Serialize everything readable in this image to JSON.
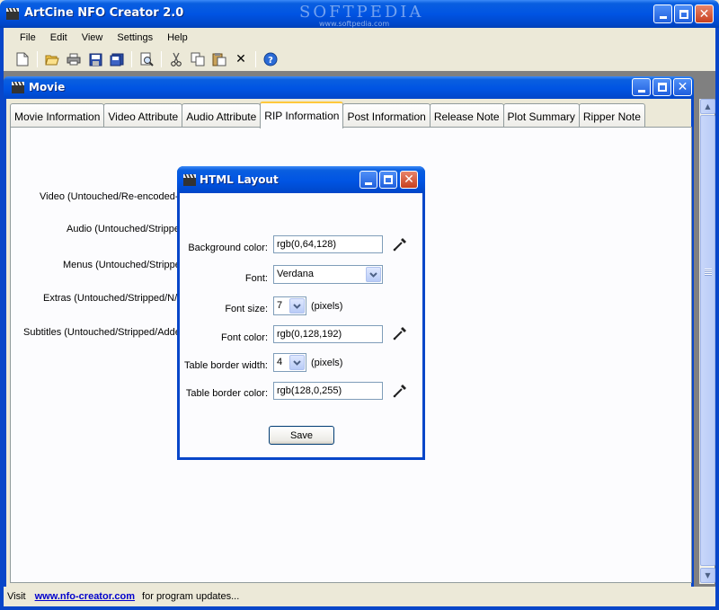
{
  "app": {
    "title": "ArtCine NFO Creator 2.0",
    "watermark": "SOFTPEDIA",
    "watermark_url": "www.softpedia.com"
  },
  "menu": [
    "File",
    "Edit",
    "View",
    "Settings",
    "Help"
  ],
  "toolbar": {
    "icons": [
      "new-icon",
      "open-icon",
      "print-icon",
      "save-icon",
      "save-as-icon",
      "preview-icon",
      "cut-icon",
      "copy-icon",
      "paste-icon",
      "delete-icon",
      "help-icon"
    ]
  },
  "child_window": {
    "title": "Movie",
    "tabs": [
      "Movie Information",
      "Video Attribute",
      "Audio Attribute",
      "RIP Information",
      "Post Information",
      "Release Note",
      "Plot Summary",
      "Ripper Note"
    ],
    "active_tab": "RIP Information",
    "form_labels": [
      "Video (Untouched/Re-encoded-",
      "Audio (Untouched/Strippe",
      "Menus (Untouched/Strippe",
      "Extras (Untouched/Stripped/N/",
      "Subtitles (Untouched/Stripped/Adde"
    ]
  },
  "dialog": {
    "title": "HTML Layout",
    "background_color": {
      "label": "Background color:",
      "value": "rgb(0,64,128)"
    },
    "font": {
      "label": "Font:",
      "value": "Verdana"
    },
    "font_size": {
      "label": "Font size:",
      "value": "7",
      "unit": "(pixels)"
    },
    "font_color": {
      "label": "Font color:",
      "value": "rgb(0,128,192)"
    },
    "table_border_width": {
      "label": "Table border width:",
      "value": "4",
      "unit": "(pixels)"
    },
    "table_border_color": {
      "label": "Table border color:",
      "value": "rgb(128,0,255)"
    },
    "save_label": "Save"
  },
  "status": {
    "prefix": "Visit",
    "link": "www.nfo-creator.com",
    "suffix": "for program updates..."
  },
  "colors": {
    "xp_blue": "#0054e3",
    "close_red": "#c8401f",
    "link_blue": "#0000cc",
    "active_tab_accent": "#ffc83c"
  }
}
